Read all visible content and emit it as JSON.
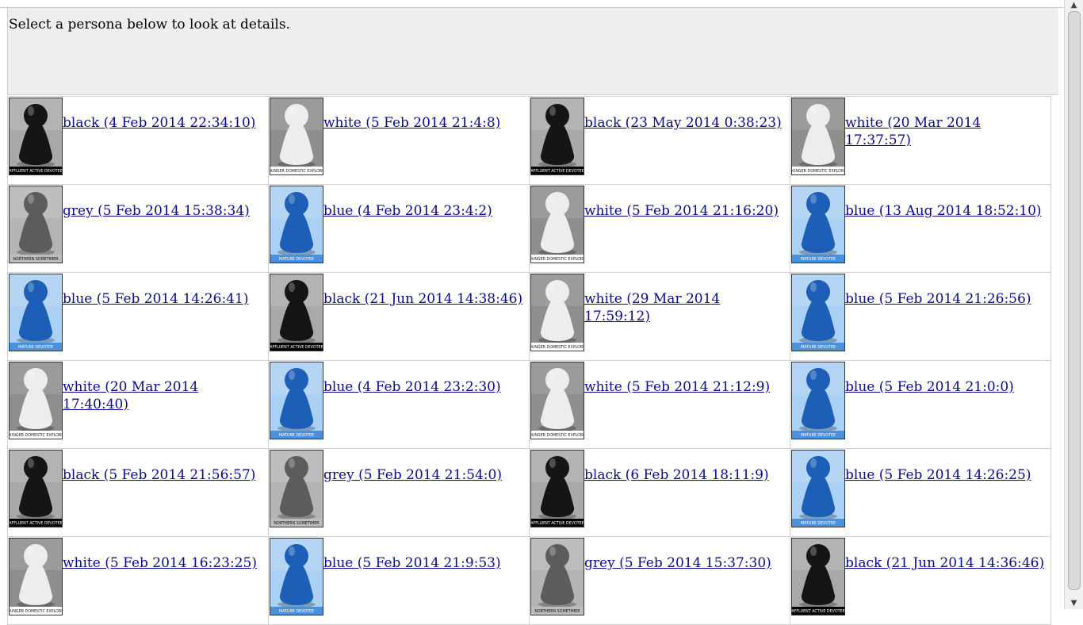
{
  "header": {
    "instruction": "Select a persona below to look at details."
  },
  "palette": {
    "black": {
      "bg": "#a9a9a9",
      "figure": "#151515",
      "band": "#000000",
      "text": "#ffffff"
    },
    "white": {
      "bg": "#8e8e8e",
      "figure": "#ededed",
      "band": "#ffffff",
      "text": "#222222"
    },
    "grey": {
      "bg": "#b4b4b4",
      "figure": "#5c5c5c",
      "band": "#bdbdbd",
      "text": "#111111"
    },
    "blue": {
      "bg": "#aad0f3",
      "figure": "#1d5eb6",
      "band": "#4a90dd",
      "text": "#ffffff"
    }
  },
  "personas": [
    {
      "color": "black",
      "caption": "AFFLUENT ACTIVE DEVOTEE",
      "label": "black (4 Feb 2014 22:34:10)"
    },
    {
      "color": "white",
      "caption": "YOUNGER DOMESTIC EXPLORER",
      "label": "white (5 Feb 2014 21:4:8)"
    },
    {
      "color": "black",
      "caption": "AFFLUENT ACTIVE DEVOTEE",
      "label": "black (23 May 2014 0:38:23)"
    },
    {
      "color": "white",
      "caption": "YOUNGER DOMESTIC EXPLORER",
      "label": "white (20 Mar 2014 17:37:57)"
    },
    {
      "color": "grey",
      "caption": "NORTHERN SOMETIMER",
      "label": "grey (5 Feb 2014 15:38:34)"
    },
    {
      "color": "blue",
      "caption": "MATURE DEVOTEE",
      "label": "blue (4 Feb 2014 23:4:2)"
    },
    {
      "color": "white",
      "caption": "YOUNGER DOMESTIC EXPLORER",
      "label": "white (5 Feb 2014 21:16:20)"
    },
    {
      "color": "blue",
      "caption": "MATURE DEVOTEE",
      "label": "blue (13 Aug 2014 18:52:10)"
    },
    {
      "color": "blue",
      "caption": "MATURE DEVOTEE",
      "label": "blue (5 Feb 2014 14:26:41)"
    },
    {
      "color": "black",
      "caption": "AFFLUENT ACTIVE DEVOTEE",
      "label": "black (21 Jun 2014 14:38:46)"
    },
    {
      "color": "white",
      "caption": "YOUNGER DOMESTIC EXPLORER",
      "label": "white (29 Mar 2014 17:59:12)"
    },
    {
      "color": "blue",
      "caption": "MATURE DEVOTEE",
      "label": "blue (5 Feb 2014 21:26:56)"
    },
    {
      "color": "white",
      "caption": "YOUNGER DOMESTIC EXPLORER",
      "label": "white (20 Mar 2014 17:40:40)"
    },
    {
      "color": "blue",
      "caption": "MATURE DEVOTEE",
      "label": "blue (4 Feb 2014 23:2:30)"
    },
    {
      "color": "white",
      "caption": "YOUNGER DOMESTIC EXPLORER",
      "label": "white (5 Feb 2014 21:12:9)"
    },
    {
      "color": "blue",
      "caption": "MATURE DEVOTEE",
      "label": "blue (5 Feb 2014 21:0:0)"
    },
    {
      "color": "black",
      "caption": "AFFLUENT ACTIVE DEVOTEE",
      "label": "black (5 Feb 2014 21:56:57)"
    },
    {
      "color": "grey",
      "caption": "NORTHERN SOMETIMER",
      "label": "grey (5 Feb 2014 21:54:0)"
    },
    {
      "color": "black",
      "caption": "AFFLUENT ACTIVE DEVOTEE",
      "label": "black (6 Feb 2014 18:11:9)"
    },
    {
      "color": "blue",
      "caption": "MATURE DEVOTEE",
      "label": "blue (5 Feb 2014 14:26:25)"
    },
    {
      "color": "white",
      "caption": "YOUNGER DOMESTIC EXPLORER",
      "label": "white (5 Feb 2014 16:23:25)"
    },
    {
      "color": "blue",
      "caption": "MATURE DEVOTEE",
      "label": "blue (5 Feb 2014 21:9:53)"
    },
    {
      "color": "grey",
      "caption": "NORTHERN SOMETIMER",
      "label": "grey (5 Feb 2014 15:37:30)"
    },
    {
      "color": "black",
      "caption": "AFFLUENT ACTIVE DEVOTEE",
      "label": "black (21 Jun 2014 14:36:46)"
    }
  ],
  "scrollbar": {
    "up_icon": "▲",
    "down_icon": "▼"
  }
}
